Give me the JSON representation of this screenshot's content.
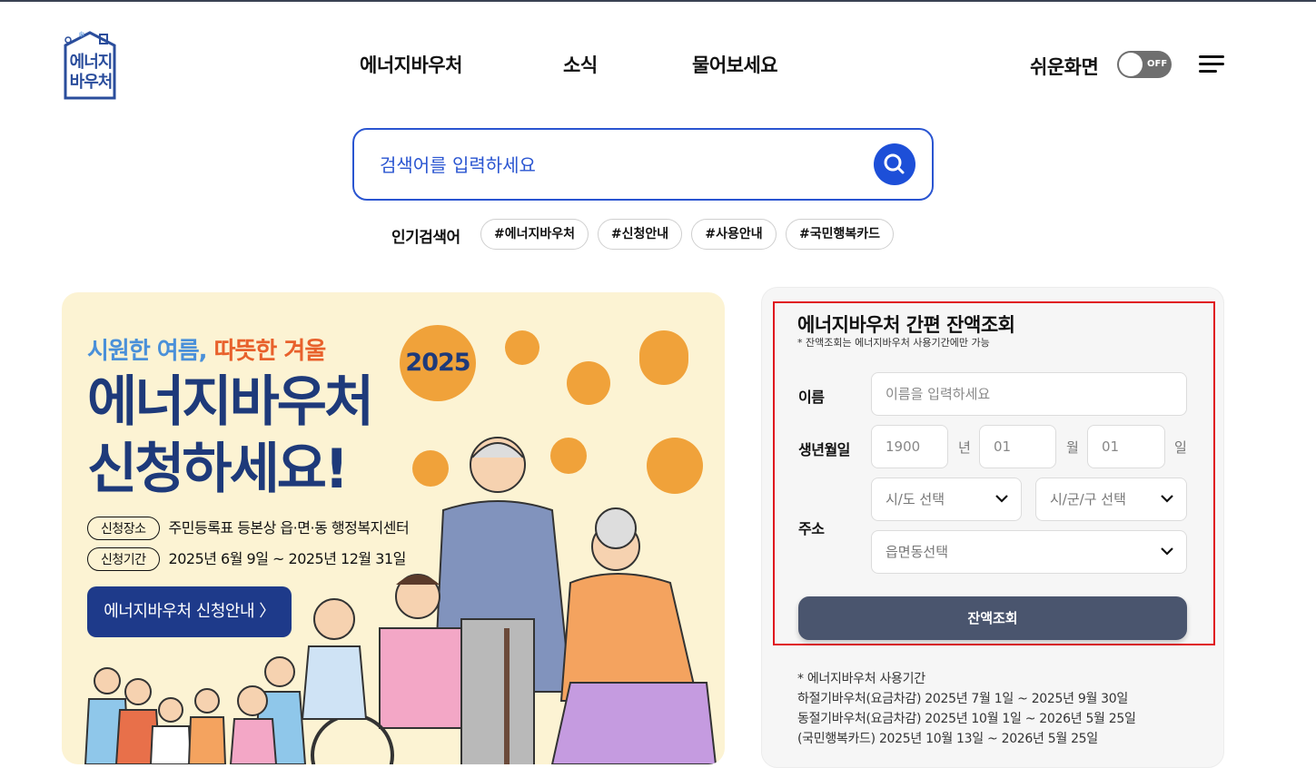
{
  "logo": {
    "line1": "에너지",
    "line2": "바우처"
  },
  "nav": {
    "items": [
      "에너지바우처",
      "소식",
      "물어보세요"
    ]
  },
  "easy_mode": {
    "label": "쉬운화면",
    "state": "OFF"
  },
  "search": {
    "placeholder": "검색어를 입력하세요"
  },
  "popular": {
    "label": "인기검색어",
    "tags": [
      "#에너지바우처",
      "#신청안내",
      "#사용안내",
      "#국민행복카드"
    ]
  },
  "banner": {
    "subtitle_a": "시원한 여름,",
    "subtitle_b": "따뜻한 겨울",
    "title_line1": "에너지바우처",
    "title_line2": "신청하세요!",
    "year": "2025",
    "place_label": "신청장소",
    "place_value": "주민등록표 등본상 읍·면·동 행정복지센터",
    "period_label": "신청기간",
    "period_value": "2025년 6월 9일 ~ 2025년 12월 31일",
    "button": "에너지바우처 신청안내 〉"
  },
  "balance": {
    "title": "에너지바우처 간편 잔액조회",
    "note": "* 잔액조회는 에너지바우처 사용기간에만 가능",
    "name_label": "이름",
    "name_placeholder": "이름을 입력하세요",
    "birth_label": "생년월일",
    "year_placeholder": "1900",
    "year_unit": "년",
    "month_placeholder": "01",
    "month_unit": "월",
    "day_placeholder": "01",
    "day_unit": "일",
    "address_label": "주소",
    "sido": "시/도 선택",
    "sigungu": "시/군/구 선택",
    "eupmyeondong": "읍면동선택",
    "submit": "잔액조회"
  },
  "usage": {
    "title": "* 에너지바우처 사용기간",
    "summer": "하절기바우처(요금차감) 2025년 7월 1일 ~ 2025년 9월 30일",
    "winter": "동절기바우처(요금차감) 2025년 10월 1일 ~ 2026년 5월 25일",
    "card": "(국민행복카드) 2025년 10월 13일 ~ 2026년 5월 25일"
  },
  "colors": {
    "primary_blue": "#1d4fd8",
    "navy": "#1e3a7a",
    "banner_bg": "#fcf3d3",
    "accent_orange": "#f0a23a",
    "highlight_red": "#e0141e",
    "button_gray": "#4a556e"
  }
}
